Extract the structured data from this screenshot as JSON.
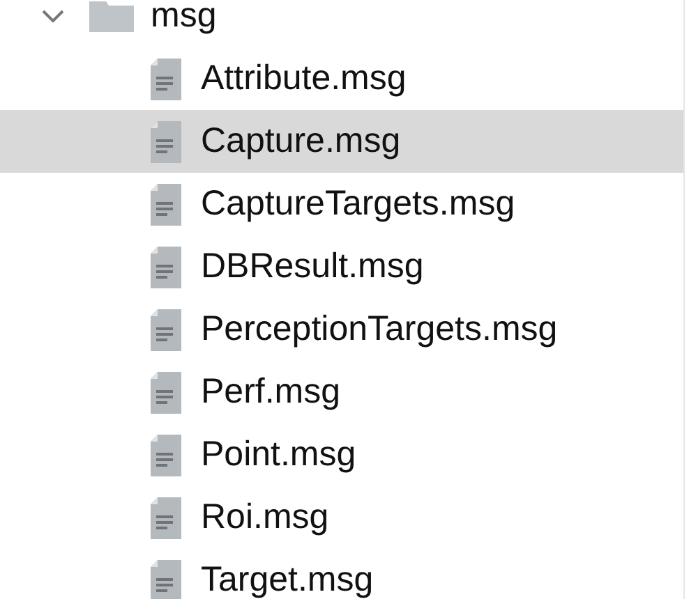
{
  "tree": {
    "label": "msg",
    "kind": "folder",
    "expanded": true,
    "selected": false,
    "children": [
      {
        "label": "Attribute.msg",
        "kind": "file",
        "selected": false
      },
      {
        "label": "Capture.msg",
        "kind": "file",
        "selected": true
      },
      {
        "label": "CaptureTargets.msg",
        "kind": "file",
        "selected": false
      },
      {
        "label": "DBResult.msg",
        "kind": "file",
        "selected": false
      },
      {
        "label": "PerceptionTargets.msg",
        "kind": "file",
        "selected": false
      },
      {
        "label": "Perf.msg",
        "kind": "file",
        "selected": false
      },
      {
        "label": "Point.msg",
        "kind": "file",
        "selected": false
      },
      {
        "label": "Roi.msg",
        "kind": "file",
        "selected": false
      },
      {
        "label": "Target.msg",
        "kind": "file",
        "selected": false
      }
    ]
  }
}
